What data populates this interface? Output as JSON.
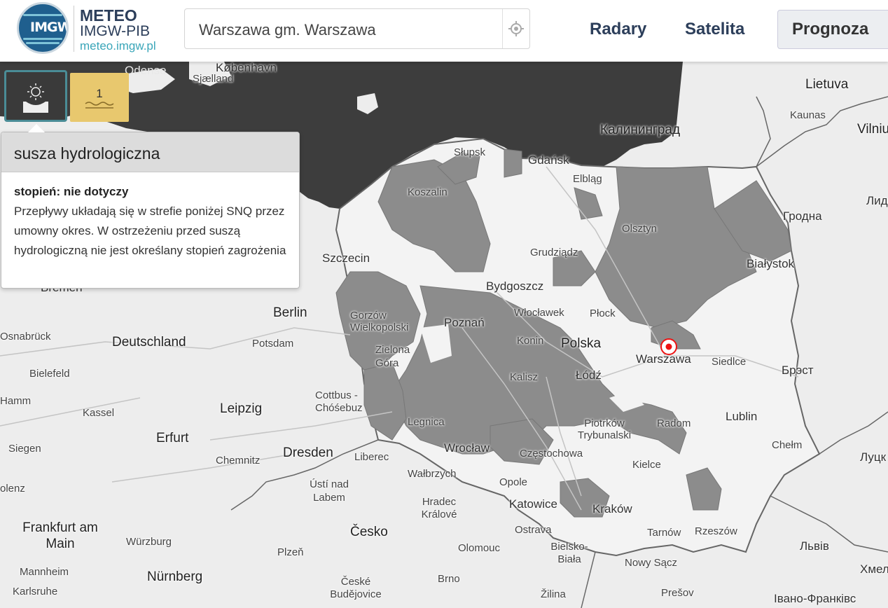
{
  "header": {
    "logo_alt": "IMGW",
    "brand_title": "METEO",
    "brand_sub": "IMGW-PIB",
    "brand_link": "meteo.imgw.pl",
    "search_value": "Warszawa gm. Warszawa",
    "nav": [
      "Radary",
      "Satelita",
      "Prognoza"
    ]
  },
  "warning": {
    "active_icon": "drought-sun-icon",
    "level_count": "1",
    "level_color": "#e8c86e"
  },
  "tooltip": {
    "title": "susza hydrologiczna",
    "degree": "stopień: nie dotyczy",
    "text": "Przepływy układają się w strefie poniżej SNQ przez umowny okres. W ostrzeżeniu przed suszą hydrologiczną nie jest określany stopień zagrożenia"
  },
  "map": {
    "labels": [
      "Odense",
      "København",
      "Sjælland",
      "Lietuva",
      "Kaunas",
      "Vilniu",
      "Калининград",
      "Słupsk",
      "Gdańsk",
      "Elbląg",
      "Koszalin",
      "Лида",
      "Olsztyn",
      "Гродна",
      "Grudziądz",
      "Szczecin",
      "Białystok",
      "Bremen",
      "Bydgoszcz",
      "Berlin",
      "Włocławek",
      "Płock",
      "Gorzów Wielkopolski",
      "Poznań",
      "Osnabrück",
      "Deutschland",
      "Potsdam",
      "Konin",
      "Polska",
      "Warszawa",
      "Siedlce",
      "Брэст",
      "Bielefeld",
      "Zielona Góra",
      "Kalisz",
      "Łódź",
      "Hamm",
      "Cottbus - Chóśebuz",
      "Kassel",
      "Leipzig",
      "Legnica",
      "Piotrków Trybunalski",
      "Radom",
      "Lublin",
      "Erfurt",
      "Wrocław",
      "Siegen",
      "Chemnitz",
      "Dresden",
      "Liberec",
      "Częstochowa",
      "Chełm",
      "Луцк",
      "Kielce",
      "Wałbrzych",
      "olenz",
      "Ústí nad Labem",
      "Opole",
      "Hradec Králové",
      "Katowice",
      "Kraków",
      "Frankfurt am Main",
      "Würzburg",
      "Česko",
      "Ostrava",
      "Tarnów",
      "Rzeszów",
      "Львів",
      "Plzeň",
      "Olomouc",
      "Bielsko-Biała",
      "Nowy Sącz",
      "Mannheim",
      "Nürnberg",
      "České Budějovice",
      "Brno",
      "Žilina",
      "Prešov",
      "Хмел",
      "Karlsruhe",
      "Івано-Франківс"
    ],
    "drought_fill": "#8c8c8c",
    "sea_color": "#3d3d3d",
    "land_color": "#ededed",
    "location_marker": "location-pin-icon"
  }
}
